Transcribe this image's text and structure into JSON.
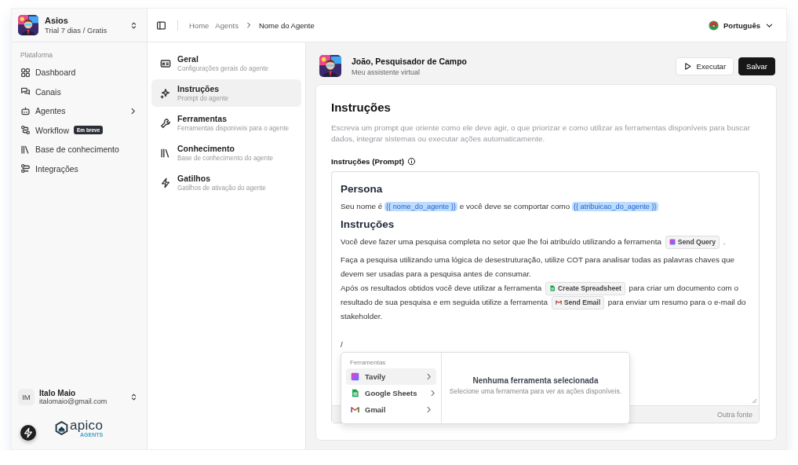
{
  "workspace": {
    "name": "Asios",
    "plan": "Trial 7 dias / Gratis"
  },
  "sidebar": {
    "section": "Plataforma",
    "items": [
      {
        "label": "Dashboard",
        "kind": "dashboard",
        "selected": false,
        "has_children": false
      },
      {
        "label": "Canais",
        "kind": "chat",
        "selected": false,
        "has_children": false
      },
      {
        "label": "Agentes",
        "kind": "bot",
        "selected": false,
        "has_children": true
      },
      {
        "label": "Workflow",
        "kind": "workflow",
        "selected": false,
        "has_children": false,
        "badge": "Em breve"
      },
      {
        "label": "Base de conhecimento",
        "kind": "books",
        "selected": false,
        "has_children": false
      },
      {
        "label": "Integrações",
        "kind": "integrations",
        "selected": false,
        "has_children": false
      }
    ]
  },
  "user": {
    "initials": "IM",
    "name": "Italo Maio",
    "email": "italomaio@gmail.com"
  },
  "logo": {
    "name": "apico",
    "tagline": "AGENTS"
  },
  "breadcrumb": [
    {
      "label": "Home",
      "current": false
    },
    {
      "label": "Agents",
      "current": false
    },
    {
      "label": "Nome do Agente",
      "current": true
    }
  ],
  "language": {
    "label": "Português"
  },
  "agent_nav": [
    {
      "title": "Geral",
      "subtitle": "Configurações gerais do agente",
      "kind": "general",
      "selected": false
    },
    {
      "title": "Instruções",
      "subtitle": "Prompt do agente",
      "kind": "instructions",
      "selected": true
    },
    {
      "title": "Ferramentas",
      "subtitle": "Ferramentas disponiveis para o agente",
      "kind": "tools",
      "selected": false
    },
    {
      "title": "Conhecimento",
      "subtitle": "Base de conhecimento do agente",
      "kind": "knowledge",
      "selected": false
    },
    {
      "title": "Gatilhos",
      "subtitle": "Gatilhos de ativação do agente",
      "kind": "triggers",
      "selected": false
    }
  ],
  "agent": {
    "name": "João, Pesquisador de Campo",
    "description": "Meu assistente virtual"
  },
  "actions": [
    {
      "label": "Executar",
      "kind": "secondary"
    },
    {
      "label": "Salvar",
      "kind": "primary"
    }
  ],
  "section": {
    "title": "Instruções",
    "description": "Escreva um prompt que oriente como ele deve agir, o que priorizar e como utilizar as ferramentas disponíveis para buscar dados, integrar sistemas ou executar ações automaticamente."
  },
  "field": {
    "label": "Instruções (Prompt)"
  },
  "prompt": {
    "blocks": [
      {
        "kind": "heading",
        "text": "Persona"
      },
      {
        "kind": "paragraph",
        "parts": [
          {
            "kind": "text",
            "text": "Seu nome é "
          },
          {
            "kind": "variable",
            "text": "{{ nome_do_agente }}"
          },
          {
            "kind": "text",
            "text": " e você deve se comportar como "
          },
          {
            "kind": "variable",
            "text": "{{ atribuicao_do_agente }}"
          }
        ]
      },
      {
        "kind": "heading",
        "text": "Instruções"
      },
      {
        "kind": "paragraph",
        "parts": [
          {
            "kind": "text",
            "text": "Você deve fazer uma pesquisa completa no setor que lhe foi atribuído utilizando a ferramenta "
          },
          {
            "kind": "search",
            "text": "Send Query"
          },
          {
            "kind": "text",
            "text": " ."
          }
        ]
      },
      {
        "kind": "paragraph",
        "parts": [
          {
            "kind": "text",
            "text": "Faça a pesquisa utilizando uma lógica de desestruturação, utilize COT para analisar todas as palavras chaves que devem ser usadas para a pesquisa antes de consumar."
          }
        ]
      },
      {
        "kind": "paragraph",
        "parts": [
          {
            "kind": "text",
            "text": "Após os resultados obtidos você deve utilizar a ferramenta "
          },
          {
            "kind": "sheets",
            "text": "Create Spreadsheet"
          },
          {
            "kind": "text",
            "text": " para criar um documento com o resultado de sua pesquisa e em seguida utilize a ferramenta "
          },
          {
            "kind": "mail",
            "text": "Send Email"
          },
          {
            "kind": "text",
            "text": " para enviar um resumo para o e-mail do stakeholder."
          }
        ]
      },
      {
        "kind": "blank"
      },
      {
        "kind": "paragraph",
        "parts": [
          {
            "kind": "text",
            "text": "/"
          }
        ]
      }
    ],
    "footer_right": "Outra fonte"
  },
  "tool_menu": {
    "heading": "Ferramentas",
    "items": [
      {
        "label": "Tavily",
        "kind": "search",
        "selected": true
      },
      {
        "label": "Google Sheets",
        "kind": "sheets",
        "selected": false
      },
      {
        "label": "Gmail",
        "kind": "mail",
        "selected": false
      }
    ],
    "empty_title": "Nenhuma ferramenta selecionada",
    "empty_text": "Selecione uma ferramenta para ver as ações disponíveis."
  }
}
